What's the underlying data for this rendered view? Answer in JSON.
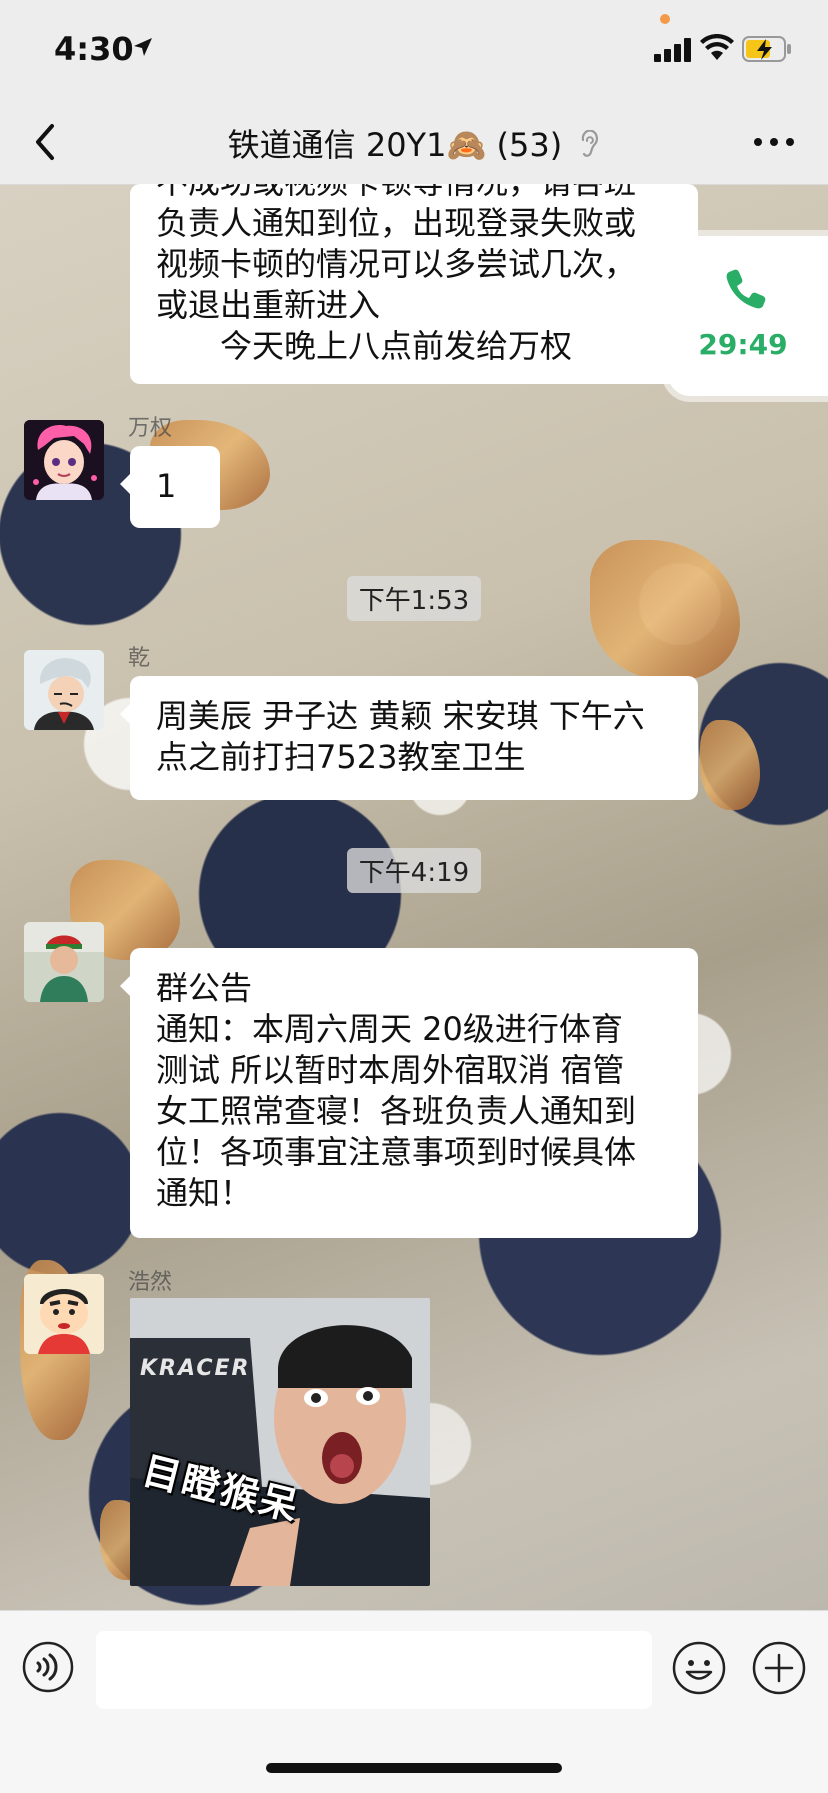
{
  "status_bar": {
    "time": "4:30"
  },
  "header": {
    "title_prefix": "铁道通信 20Y1",
    "title_emoji": "🙈",
    "member_count": "(53)"
  },
  "call_widget": {
    "timer": "29:49",
    "color": "#2aae67"
  },
  "messages": [
    {
      "type": "text",
      "lines": [
        "不成功或视频卡顿等情况，请各班",
        "负责人通知到位，出现登录失败或",
        "视频卡顿的情况可以多尝试几次，",
        "或退出重新进入",
        "　　今天晚上八点前发给万权"
      ]
    },
    {
      "type": "text",
      "sender": "万权",
      "text": "1"
    },
    {
      "type": "timestamp",
      "text": "下午1:53"
    },
    {
      "type": "text",
      "sender": "乾",
      "lines": [
        "周美辰 尹子达 黄颖 宋安琪 下午六",
        "点之前打扫7523教室卫生"
      ]
    },
    {
      "type": "timestamp",
      "text": "下午4:19"
    },
    {
      "type": "text",
      "lines": [
        "群公告",
        "通知：本周六周天 20级进行体育",
        "测试 所以暂时本周外宿取消 宿管",
        "女工照常查寝！各班负责人通知到",
        "位！各项事宜注意事项到时候具体",
        "通知！"
      ]
    },
    {
      "type": "sticker",
      "sender": "浩然",
      "caption": "目瞪猴呆",
      "brand": "KRACER"
    }
  ]
}
